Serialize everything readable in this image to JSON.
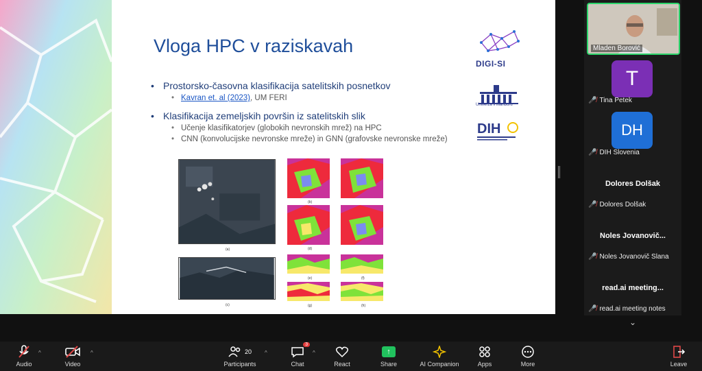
{
  "slide": {
    "title": "Vloga HPC v raziskavah",
    "bullets": [
      {
        "text": "Prostorsko-časovna klasifikacija satelitskih posnetkov",
        "sub": [
          {
            "link": "Kavran et. al (2023)",
            "text": ", UM FERI"
          }
        ]
      },
      {
        "text": "Klasifikacija zemeljskih površin iz satelitskih slik",
        "sub": [
          {
            "text": "Učenje klasifikatorjev (globokih nevronskih mrež) na HPC"
          },
          {
            "text": "CNN (konvolucijske nevronske mreže) in GNN (grafovske nevronske mreže)"
          }
        ]
      }
    ],
    "logos": {
      "digi": "DIGI-SI",
      "um": "Univerza v Mariboru",
      "dih": "DIH"
    },
    "figure_captions": [
      "(a)",
      "(b)",
      "(c)",
      "(d)",
      "(e)",
      "(f)",
      "(g)",
      "(h)"
    ]
  },
  "participants": {
    "self": {
      "name": "Mladen Borović"
    },
    "list": [
      {
        "name": "Tina Petek",
        "avatar_letter": "T",
        "avatar_color": "#7b2fb5"
      },
      {
        "name": "DIH Slovenia",
        "avatar_letter": "DH",
        "avatar_color": "#1f6fd6"
      },
      {
        "big": "Dolores Dolšak",
        "name": "Dolores Dolšak"
      },
      {
        "big": "Noles  Jovanovič...",
        "name": "Noles Jovanovič Slana"
      },
      {
        "big": "read.ai  meeting...",
        "name": "read.ai meeting notes"
      }
    ]
  },
  "toolbar": {
    "audio": "Audio",
    "video": "Video",
    "participants": "Participants",
    "participants_count": "20",
    "chat": "Chat",
    "chat_badge": "3",
    "react": "React",
    "share": "Share",
    "ai": "AI Companion",
    "apps": "Apps",
    "more": "More",
    "leave": "Leave"
  },
  "colors": {
    "accent": "#1f4e9a",
    "share": "#21c25e",
    "mic_off": "#e04848"
  }
}
